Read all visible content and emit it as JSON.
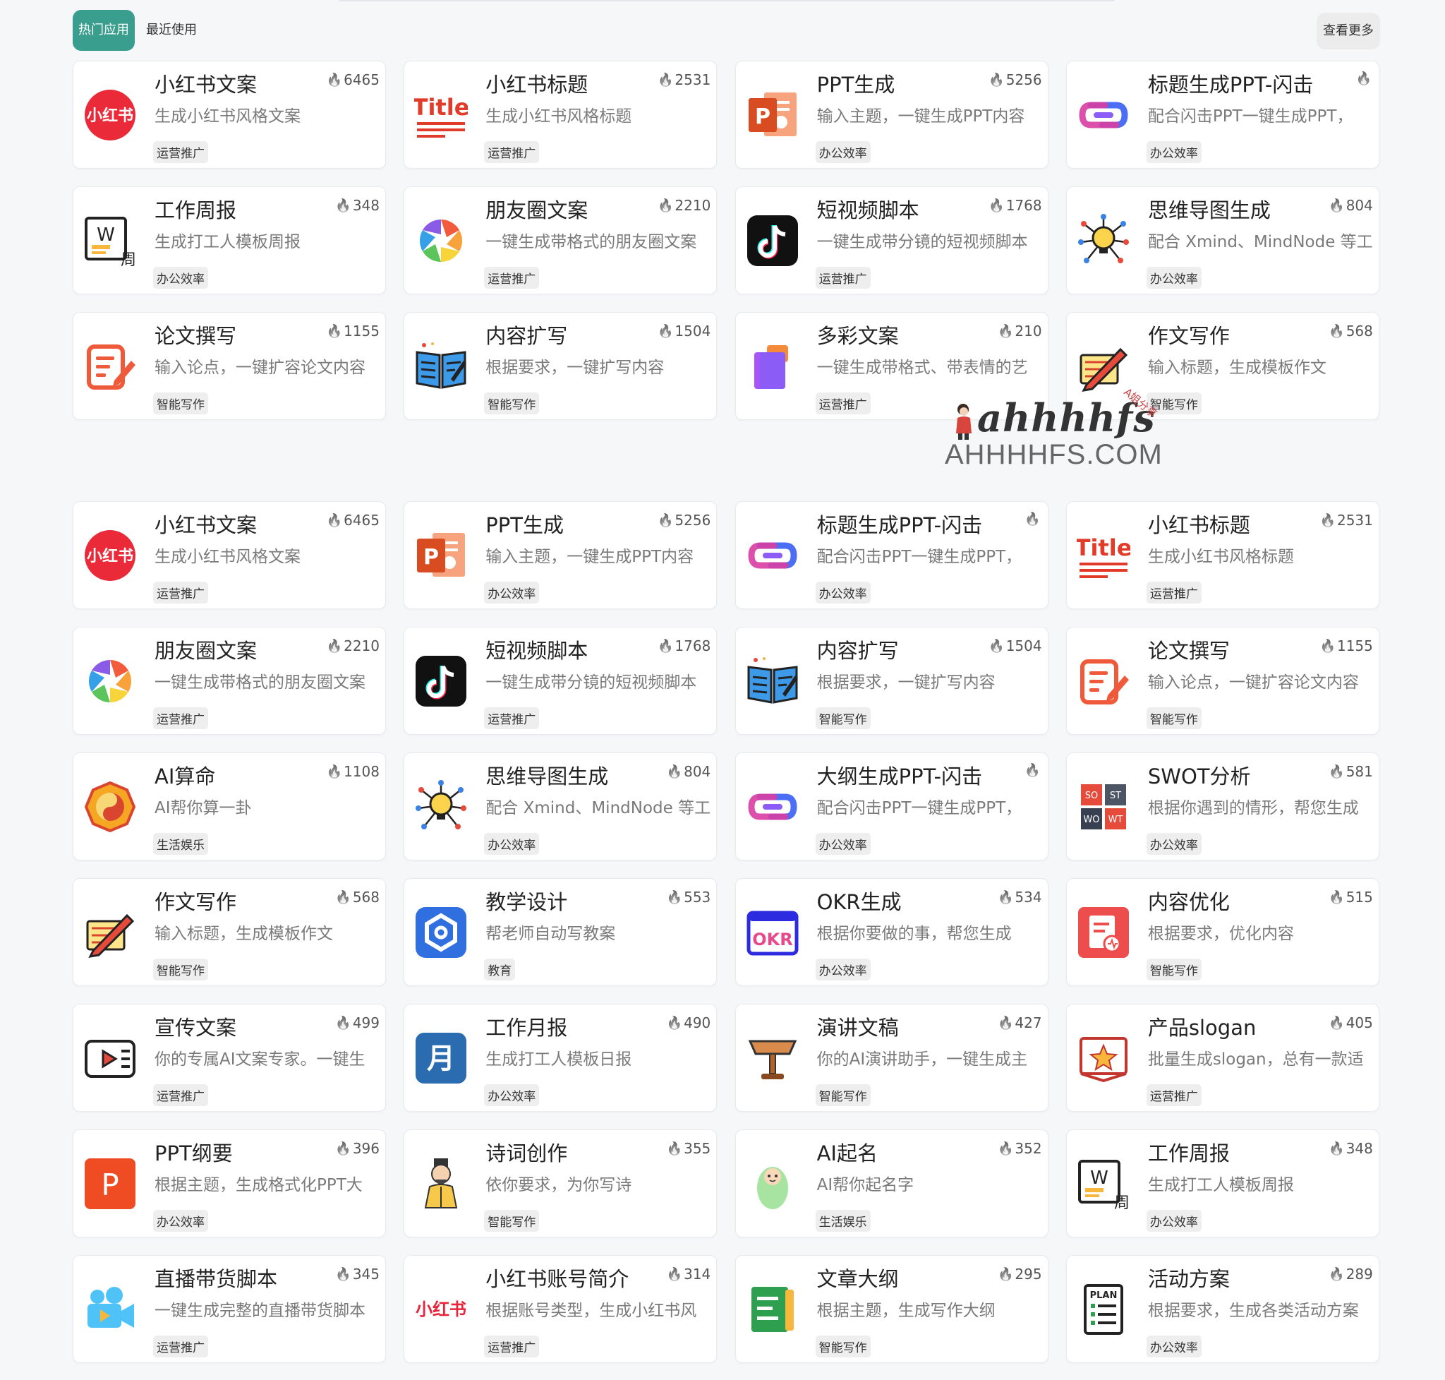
{
  "tabs": [
    {
      "label": "热门应用",
      "active": true
    },
    {
      "label": "最近使用",
      "active": false
    }
  ],
  "more_label": "查看更多",
  "watermark": {
    "script": "ahhhhfs",
    "sub": "A姐分享",
    "domain": "AHHHHFS.COM"
  },
  "hot_icon": "flame-icon",
  "section1": [
    {
      "icon": "xiaohongshu-icon",
      "title": "小红书文案",
      "hot": "6465",
      "desc": "生成小红书风格文案",
      "tag": "运营推广"
    },
    {
      "icon": "title-icon",
      "title": "小红书标题",
      "hot": "2531",
      "desc": "生成小红书风格标题",
      "tag": "运营推广"
    },
    {
      "icon": "ppt-icon",
      "title": "PPT生成",
      "hot": "5256",
      "desc": "输入主题，一键生成PPT内容",
      "tag": "办公效率"
    },
    {
      "icon": "shandian-icon",
      "title": "标题生成PPT-闪击",
      "hot": "",
      "desc": "配合闪击PPT一键生成PPT，",
      "tag": "办公效率"
    },
    {
      "icon": "word-week-icon",
      "title": "工作周报",
      "hot": "348",
      "desc": "生成打工人模板周报",
      "tag": "办公效率"
    },
    {
      "icon": "aperture-icon",
      "title": "朋友圈文案",
      "hot": "2210",
      "desc": "一键生成带格式的朋友圈文案",
      "tag": "运营推广"
    },
    {
      "icon": "tiktok-icon",
      "title": "短视频脚本",
      "hot": "1768",
      "desc": "一键生成带分镜的短视频脚本",
      "tag": "运营推广"
    },
    {
      "icon": "mindmap-icon",
      "title": "思维导图生成",
      "hot": "804",
      "desc": "配合 Xmind、MindNode 等工",
      "tag": "办公效率"
    },
    {
      "icon": "edit-note-icon",
      "title": "论文撰写",
      "hot": "1155",
      "desc": "输入论点，一键扩容论文内容",
      "tag": "智能写作"
    },
    {
      "icon": "book-icon",
      "title": "内容扩写",
      "hot": "1504",
      "desc": "根据要求，一键扩写内容",
      "tag": "智能写作"
    },
    {
      "icon": "colorful-doc-icon",
      "title": "多彩文案",
      "hot": "210",
      "desc": "一键生成带格式、带表情的艺",
      "tag": "运营推广"
    },
    {
      "icon": "essay-icon",
      "title": "作文写作",
      "hot": "568",
      "desc": "输入标题，生成模板作文",
      "tag": "智能写作"
    }
  ],
  "section2": [
    {
      "icon": "xiaohongshu-icon",
      "title": "小红书文案",
      "hot": "6465",
      "desc": "生成小红书风格文案",
      "tag": "运营推广"
    },
    {
      "icon": "ppt-icon",
      "title": "PPT生成",
      "hot": "5256",
      "desc": "输入主题，一键生成PPT内容",
      "tag": "办公效率"
    },
    {
      "icon": "shandian-icon",
      "title": "标题生成PPT-闪击",
      "hot": "",
      "desc": "配合闪击PPT一键生成PPT，",
      "tag": "办公效率"
    },
    {
      "icon": "title-icon",
      "title": "小红书标题",
      "hot": "2531",
      "desc": "生成小红书风格标题",
      "tag": "运营推广"
    },
    {
      "icon": "aperture-icon",
      "title": "朋友圈文案",
      "hot": "2210",
      "desc": "一键生成带格式的朋友圈文案",
      "tag": "运营推广"
    },
    {
      "icon": "tiktok-icon",
      "title": "短视频脚本",
      "hot": "1768",
      "desc": "一键生成带分镜的短视频脚本",
      "tag": "运营推广"
    },
    {
      "icon": "book-icon",
      "title": "内容扩写",
      "hot": "1504",
      "desc": "根据要求，一键扩写内容",
      "tag": "智能写作"
    },
    {
      "icon": "edit-note-icon",
      "title": "论文撰写",
      "hot": "1155",
      "desc": "输入论点，一键扩容论文内容",
      "tag": "智能写作"
    },
    {
      "icon": "bagua-icon",
      "title": "AI算命",
      "hot": "1108",
      "desc": "AI帮你算一卦",
      "tag": "生活娱乐"
    },
    {
      "icon": "mindmap-icon",
      "title": "思维导图生成",
      "hot": "804",
      "desc": "配合 Xmind、MindNode 等工",
      "tag": "办公效率"
    },
    {
      "icon": "shandian-icon",
      "title": "大纲生成PPT-闪击",
      "hot": "",
      "desc": "配合闪击PPT一键生成PPT，",
      "tag": "办公效率"
    },
    {
      "icon": "swot-icon",
      "title": "SWOT分析",
      "hot": "581",
      "desc": "根据你遇到的情形，帮您生成",
      "tag": "办公效率"
    },
    {
      "icon": "essay-icon",
      "title": "作文写作",
      "hot": "568",
      "desc": "输入标题，生成模板作文",
      "tag": "智能写作"
    },
    {
      "icon": "teaching-icon",
      "title": "教学设计",
      "hot": "553",
      "desc": "帮老师自动写教案",
      "tag": "教育"
    },
    {
      "icon": "okr-icon",
      "title": "OKR生成",
      "hot": "534",
      "desc": "根据你要做的事，帮您生成",
      "tag": "办公效率"
    },
    {
      "icon": "optimize-icon",
      "title": "内容优化",
      "hot": "515",
      "desc": "根据要求，优化内容",
      "tag": "智能写作"
    },
    {
      "icon": "video-play-icon",
      "title": "宣传文案",
      "hot": "499",
      "desc": "你的专属AI文案专家。一键生",
      "tag": "运营推广"
    },
    {
      "icon": "month-icon",
      "title": "工作月报",
      "hot": "490",
      "desc": "生成打工人模板日报",
      "tag": "办公效率"
    },
    {
      "icon": "podium-icon",
      "title": "演讲文稿",
      "hot": "427",
      "desc": "你的AI演讲助手，一键生成主",
      "tag": "智能写作"
    },
    {
      "icon": "slogan-icon",
      "title": "产品slogan",
      "hot": "405",
      "desc": "批量生成slogan，总有一款适",
      "tag": "运营推广"
    },
    {
      "icon": "ppt-outline-icon",
      "title": "PPT纲要",
      "hot": "396",
      "desc": "根据主题，生成格式化PPT大",
      "tag": "办公效率"
    },
    {
      "icon": "poet-icon",
      "title": "诗词创作",
      "hot": "355",
      "desc": "依你要求，为你写诗",
      "tag": "智能写作"
    },
    {
      "icon": "baby-icon",
      "title": "AI起名",
      "hot": "352",
      "desc": "AI帮你起名字",
      "tag": "生活娱乐"
    },
    {
      "icon": "word-week-icon",
      "title": "工作周报",
      "hot": "348",
      "desc": "生成打工人模板周报",
      "tag": "办公效率"
    },
    {
      "icon": "camera-icon",
      "title": "直播带货脚本",
      "hot": "345",
      "desc": "一键生成完整的直播带货脚本",
      "tag": "运营推广"
    },
    {
      "icon": "xiaohongshu-text-icon",
      "title": "小红书账号简介",
      "hot": "314",
      "desc": "根据账号类型，生成小红书风",
      "tag": "运营推广"
    },
    {
      "icon": "outline-icon",
      "title": "文章大纲",
      "hot": "295",
      "desc": "根据主题，生成写作大纲",
      "tag": "智能写作"
    },
    {
      "icon": "plan-icon",
      "title": "活动方案",
      "hot": "289",
      "desc": "根据要求，生成各类活动方案",
      "tag": "办公效率"
    }
  ]
}
